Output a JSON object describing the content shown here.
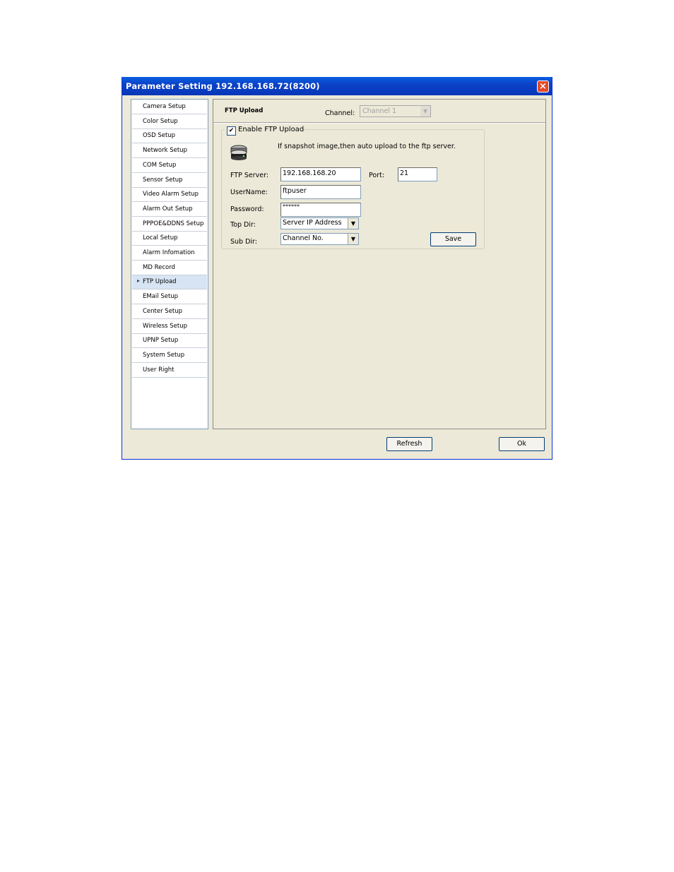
{
  "window": {
    "title": "Parameter Setting 192.168.168.72(8200)",
    "close_glyph": "×"
  },
  "sidebar": {
    "items": [
      {
        "label": "Camera Setup"
      },
      {
        "label": "Color Setup"
      },
      {
        "label": "OSD Setup"
      },
      {
        "label": "Network Setup"
      },
      {
        "label": "COM Setup"
      },
      {
        "label": "Sensor Setup"
      },
      {
        "label": "Video Alarm Setup"
      },
      {
        "label": "Alarm Out Setup"
      },
      {
        "label": "PPPOE&DDNS Setup"
      },
      {
        "label": "Local Setup"
      },
      {
        "label": "Alarm Infomation"
      },
      {
        "label": "MD Record"
      },
      {
        "label": "FTP Upload",
        "selected": true
      },
      {
        "label": "EMail Setup"
      },
      {
        "label": "Center Setup"
      },
      {
        "label": "Wireless Setup"
      },
      {
        "label": "UPNP Setup"
      },
      {
        "label": "System Setup"
      },
      {
        "label": "User Right"
      }
    ],
    "selected_indicator": "▸"
  },
  "main": {
    "section_title": "FTP Upload",
    "channel_label": "Channel:",
    "channel_value": "Channel 1",
    "enable_ftp": {
      "label": "Enable FTP Upload",
      "checked": true,
      "check_glyph": "✔"
    },
    "info_text": "If snapshot image,then auto upload to the ftp server.",
    "icon": "server-icon",
    "ftp_server": {
      "label": "FTP Server:",
      "value": "192.168.168.20"
    },
    "port": {
      "label": "Port:",
      "value": "21"
    },
    "username": {
      "label": "UserName:",
      "value": "ftpuser"
    },
    "password": {
      "label": "Password:",
      "value": "******"
    },
    "top_dir": {
      "label": "Top Dir:",
      "value": "Server IP Address"
    },
    "sub_dir": {
      "label": "Sub Dir:",
      "value": "Channel No."
    },
    "save_label": "Save",
    "dropdown_glyph": "▼"
  },
  "footer": {
    "refresh_label": "Refresh",
    "ok_label": "Ok"
  },
  "colors": {
    "titlebar": "#0A4FD4",
    "dialog_bg": "#ECE9D8",
    "close_button": "#E24A2A"
  }
}
